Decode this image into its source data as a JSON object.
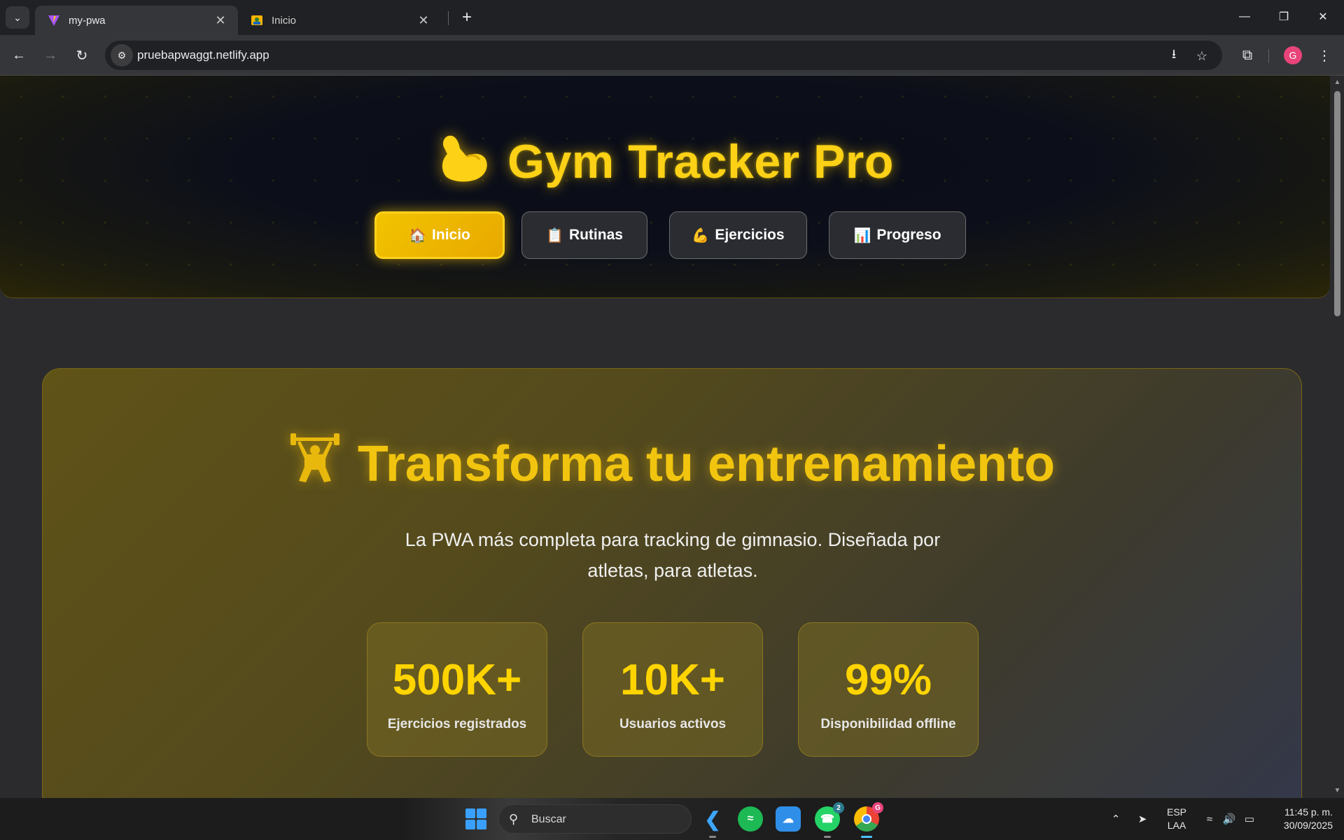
{
  "browser": {
    "tabs": [
      {
        "title": "my-pwa",
        "active": true
      },
      {
        "title": "Inicio",
        "active": false
      }
    ],
    "url": "pruebapwaggt.netlify.app",
    "profile_initial": "G"
  },
  "app": {
    "title": "Gym Tracker Pro",
    "title_icon": "flexed-biceps-icon",
    "nav": [
      {
        "label": "Inicio",
        "icon": "🏠",
        "active": true
      },
      {
        "label": "Rutinas",
        "icon": "📋",
        "active": false
      },
      {
        "label": "Ejercicios",
        "icon": "💪",
        "active": false
      },
      {
        "label": "Progreso",
        "icon": "📊",
        "active": false
      }
    ]
  },
  "hero": {
    "title": "Transforma tu entrenamiento",
    "title_icon": "weightlifter-icon",
    "subtitle": "La PWA más completa para tracking de gimnasio. Diseñada por atletas, para atletas.",
    "stats": [
      {
        "value": "500K+",
        "label": "Ejercicios registrados"
      },
      {
        "value": "10K+",
        "label": "Usuarios activos"
      },
      {
        "value": "99%",
        "label": "Disponibilidad offline"
      }
    ]
  },
  "taskbar": {
    "search_placeholder": "Buscar",
    "whatsapp_badge": "2",
    "chrome_badge": "G",
    "language": "ESP",
    "keyboard": "LAA",
    "time": "11:45 p. m.",
    "date": "30/09/2025"
  },
  "colors": {
    "accent_yellow": "#fcd116",
    "nav_active": "#f2c400",
    "header_bg": "#0c0f1a",
    "page_bg": "#2b2b2e"
  }
}
